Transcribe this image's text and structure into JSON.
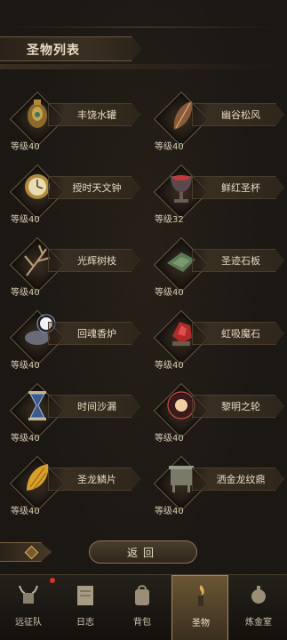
{
  "header": {
    "title": "圣物列表"
  },
  "relics": [
    {
      "name": "丰饶水罐",
      "level": "等级40",
      "icon": "golden-jar-icon"
    },
    {
      "name": "幽谷松风",
      "level": "等级40",
      "icon": "feather-leaf-icon"
    },
    {
      "name": "授时天文钟",
      "level": "等级40",
      "icon": "astronomical-clock-icon"
    },
    {
      "name": "鲜红圣杯",
      "level": "等级32",
      "icon": "crimson-chalice-icon"
    },
    {
      "name": "光辉树枝",
      "level": "等级40",
      "icon": "radiant-branch-icon"
    },
    {
      "name": "圣迹石板",
      "level": "等级40",
      "icon": "stone-tablet-icon"
    },
    {
      "name": "回魂香炉",
      "level": "等级40",
      "icon": "incense-burner-icon"
    },
    {
      "name": "虹吸魔石",
      "level": "等级40",
      "icon": "siphon-stone-icon"
    },
    {
      "name": "时间沙漏",
      "level": "等级40",
      "icon": "hourglass-icon"
    },
    {
      "name": "黎明之轮",
      "level": "等级40",
      "icon": "dawn-wheel-icon"
    },
    {
      "name": "圣龙鳞片",
      "level": "等级40",
      "icon": "dragon-scale-icon"
    },
    {
      "name": "洒金龙纹鼎",
      "level": "等级40",
      "icon": "dragon-cauldron-icon"
    }
  ],
  "actions": {
    "return_label": "返回"
  },
  "nav": [
    {
      "label": "远征队",
      "icon": "horned-helmet-icon"
    },
    {
      "label": "日志",
      "icon": "journal-icon"
    },
    {
      "label": "背包",
      "icon": "backpack-icon"
    },
    {
      "label": "圣物",
      "icon": "relic-torch-icon"
    },
    {
      "label": "炼金室",
      "icon": "alchemy-icon"
    }
  ]
}
